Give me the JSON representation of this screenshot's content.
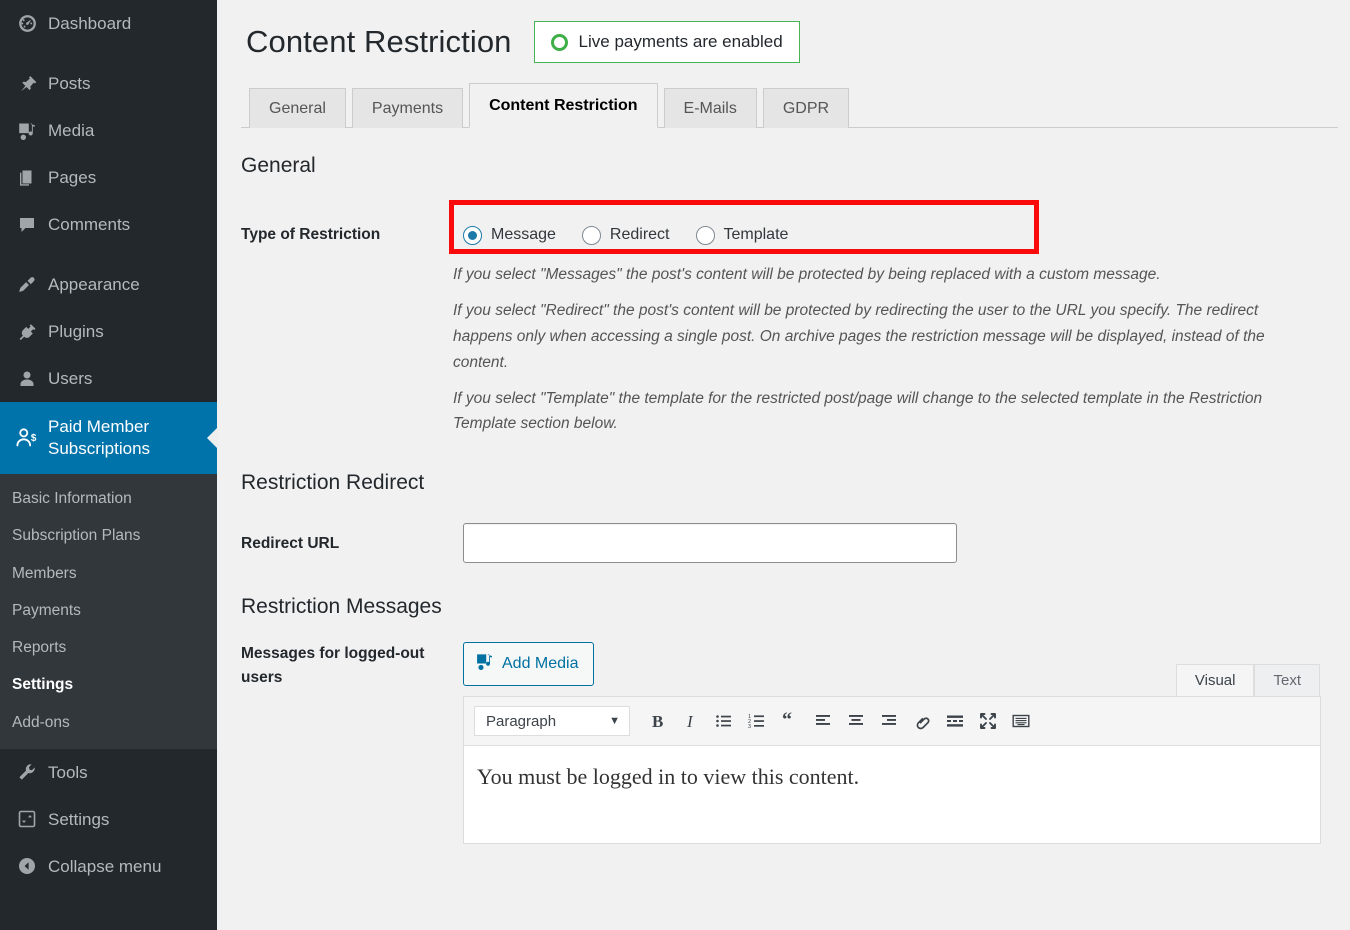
{
  "sidebar": {
    "top_items": [
      {
        "label": "Dashboard",
        "icon": "dashboard-gauge-icon"
      },
      {
        "label": "Posts",
        "icon": "pin-icon"
      },
      {
        "label": "Media",
        "icon": "media-icon"
      },
      {
        "label": "Pages",
        "icon": "pages-icon"
      },
      {
        "label": "Comments",
        "icon": "comment-bubble-icon"
      },
      {
        "label": "Appearance",
        "icon": "paintbrush-icon"
      },
      {
        "label": "Plugins",
        "icon": "plug-icon"
      },
      {
        "label": "Users",
        "icon": "user-icon"
      }
    ],
    "active_item": {
      "label": "Paid Member Subscriptions",
      "icon": "user-dollar-icon"
    },
    "submenu": [
      {
        "label": "Basic Information",
        "current": false
      },
      {
        "label": "Subscription Plans",
        "current": false
      },
      {
        "label": "Members",
        "current": false
      },
      {
        "label": "Payments",
        "current": false
      },
      {
        "label": "Reports",
        "current": false
      },
      {
        "label": "Settings",
        "current": true
      },
      {
        "label": "Add-ons",
        "current": false
      }
    ],
    "lower_items": [
      {
        "label": "Tools",
        "icon": "wrench-icon"
      },
      {
        "label": "Settings",
        "icon": "settings-sliders-icon"
      },
      {
        "label": "Collapse menu",
        "icon": "collapse-arrow-icon"
      }
    ],
    "accent_color": "#0073aa",
    "background_color": "#23282d"
  },
  "header": {
    "title": "Content Restriction",
    "badge": {
      "text": "Live payments are enabled",
      "icon": "green-ring-icon",
      "color": "#46b450"
    }
  },
  "tabs": [
    {
      "label": "General",
      "active": false
    },
    {
      "label": "Payments",
      "active": false
    },
    {
      "label": "Content Restriction",
      "active": true
    },
    {
      "label": "E-Mails",
      "active": false
    },
    {
      "label": "GDPR",
      "active": false
    }
  ],
  "general_section": {
    "heading": "General",
    "restriction_label": "Type of Restriction",
    "options": [
      {
        "label": "Message",
        "selected": true
      },
      {
        "label": "Redirect",
        "selected": false
      },
      {
        "label": "Template",
        "selected": false
      }
    ],
    "highlight_color": "#fa0a0a",
    "descriptions": [
      "If you select \"Messages\" the post's content will be protected by being replaced with a custom message.",
      "If you select \"Redirect\" the post's content will be protected by redirecting the user to the URL you specify. The redirect happens only when accessing a single post. On archive pages the restriction message will be displayed, instead of the content.",
      "If you select \"Template\" the template for the restricted post/page will change to the selected template in the Restriction Template section below."
    ]
  },
  "redirect_section": {
    "heading": "Restriction Redirect",
    "field_label": "Redirect URL",
    "field_value": "",
    "field_placeholder": ""
  },
  "messages_section": {
    "heading": "Restriction Messages",
    "field_label": "Messages for logged-out users",
    "add_media_label": "Add Media",
    "add_media_icon": "media-icon",
    "editor_tabs": [
      {
        "label": "Visual",
        "active": true
      },
      {
        "label": "Text",
        "active": false
      }
    ],
    "format_select": "Paragraph",
    "toolbar_buttons": [
      "bold-icon",
      "italic-icon",
      "bulleted-list-icon",
      "numbered-list-icon",
      "blockquote-icon",
      "align-left-icon",
      "align-center-icon",
      "align-right-icon",
      "link-icon",
      "insert-read-more-icon",
      "fullscreen-icon",
      "toolbar-toggle-icon"
    ],
    "content": "You must be logged in to view this content."
  }
}
